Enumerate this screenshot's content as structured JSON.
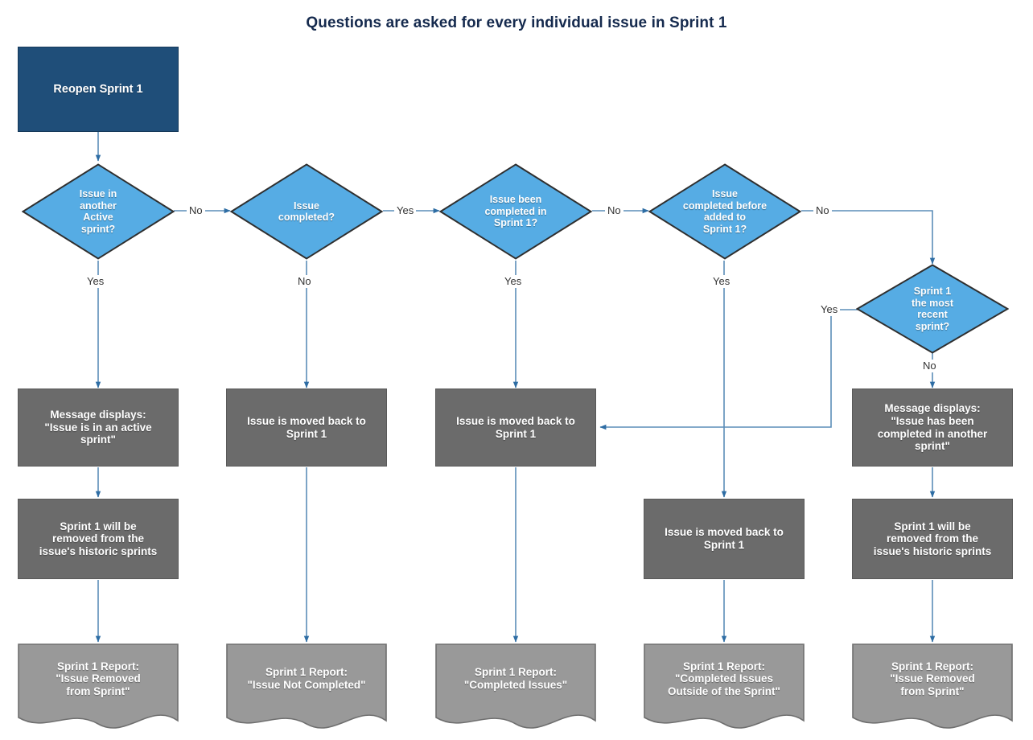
{
  "diagram": {
    "title": "Questions are asked for every individual issue in Sprint 1",
    "colors": {
      "start_fill": "#1f4e79",
      "decision_fill": "#56ace4",
      "process_fill": "#6b6b6b",
      "document_fill": "#999999",
      "connector": "#5b8db8",
      "title_text": "#152a4e",
      "node_text": "#ffffff",
      "edge_label_text": "#333333"
    },
    "nodes": {
      "start": {
        "label": "Reopen Sprint 1",
        "shape": "rectangle"
      },
      "d1": {
        "label": "Issue in\nanother\nActive\nsprint?",
        "shape": "diamond"
      },
      "d2": {
        "label": "Issue\ncompleted?",
        "shape": "diamond"
      },
      "d3": {
        "label": "Issue been\ncompleted in\nSprint 1?",
        "shape": "diamond"
      },
      "d4": {
        "label": "Issue\ncompleted before\nadded to\nSprint 1?",
        "shape": "diamond"
      },
      "d5": {
        "label": "Sprint 1\nthe most\nrecent\nsprint?",
        "shape": "diamond"
      },
      "p1": {
        "label": "Message displays:\n\"Issue is in an active\nsprint\"",
        "shape": "rectangle"
      },
      "p2": {
        "label": "Issue is moved back to\nSprint 1",
        "shape": "rectangle"
      },
      "p3": {
        "label": "Issue is moved back to\nSprint 1",
        "shape": "rectangle"
      },
      "p4": {
        "label": "Message displays:\n\"Issue has been\ncompleted in another\nsprint\"",
        "shape": "rectangle"
      },
      "p5": {
        "label": "Sprint 1 will be\nremoved from the\nissue's historic sprints",
        "shape": "rectangle"
      },
      "p6": {
        "label": "Issue is moved back to\nSprint 1",
        "shape": "rectangle"
      },
      "p7": {
        "label": "Sprint 1 will be\nremoved from the\nissue's historic sprints",
        "shape": "rectangle"
      },
      "r1": {
        "label": "Sprint 1 Report:\n\"Issue Removed\nfrom Sprint\"",
        "shape": "document"
      },
      "r2": {
        "label": "Sprint 1 Report:\n\"Issue Not Completed\"",
        "shape": "document"
      },
      "r3": {
        "label": "Sprint 1 Report:\n\"Completed Issues\"",
        "shape": "document"
      },
      "r4": {
        "label": "Sprint 1 Report:\n\"Completed Issues\nOutside of the Sprint\"",
        "shape": "document"
      },
      "r5": {
        "label": "Sprint 1 Report:\n\"Issue Removed\nfrom Sprint\"",
        "shape": "document"
      }
    },
    "edge_labels": {
      "d1_no": "No",
      "d1_yes": "Yes",
      "d2_yes": "Yes",
      "d2_no": "No",
      "d3_no": "No",
      "d3_yes": "Yes",
      "d4_no": "No",
      "d4_yes": "Yes",
      "d5_yes": "Yes",
      "d5_no": "No"
    }
  }
}
